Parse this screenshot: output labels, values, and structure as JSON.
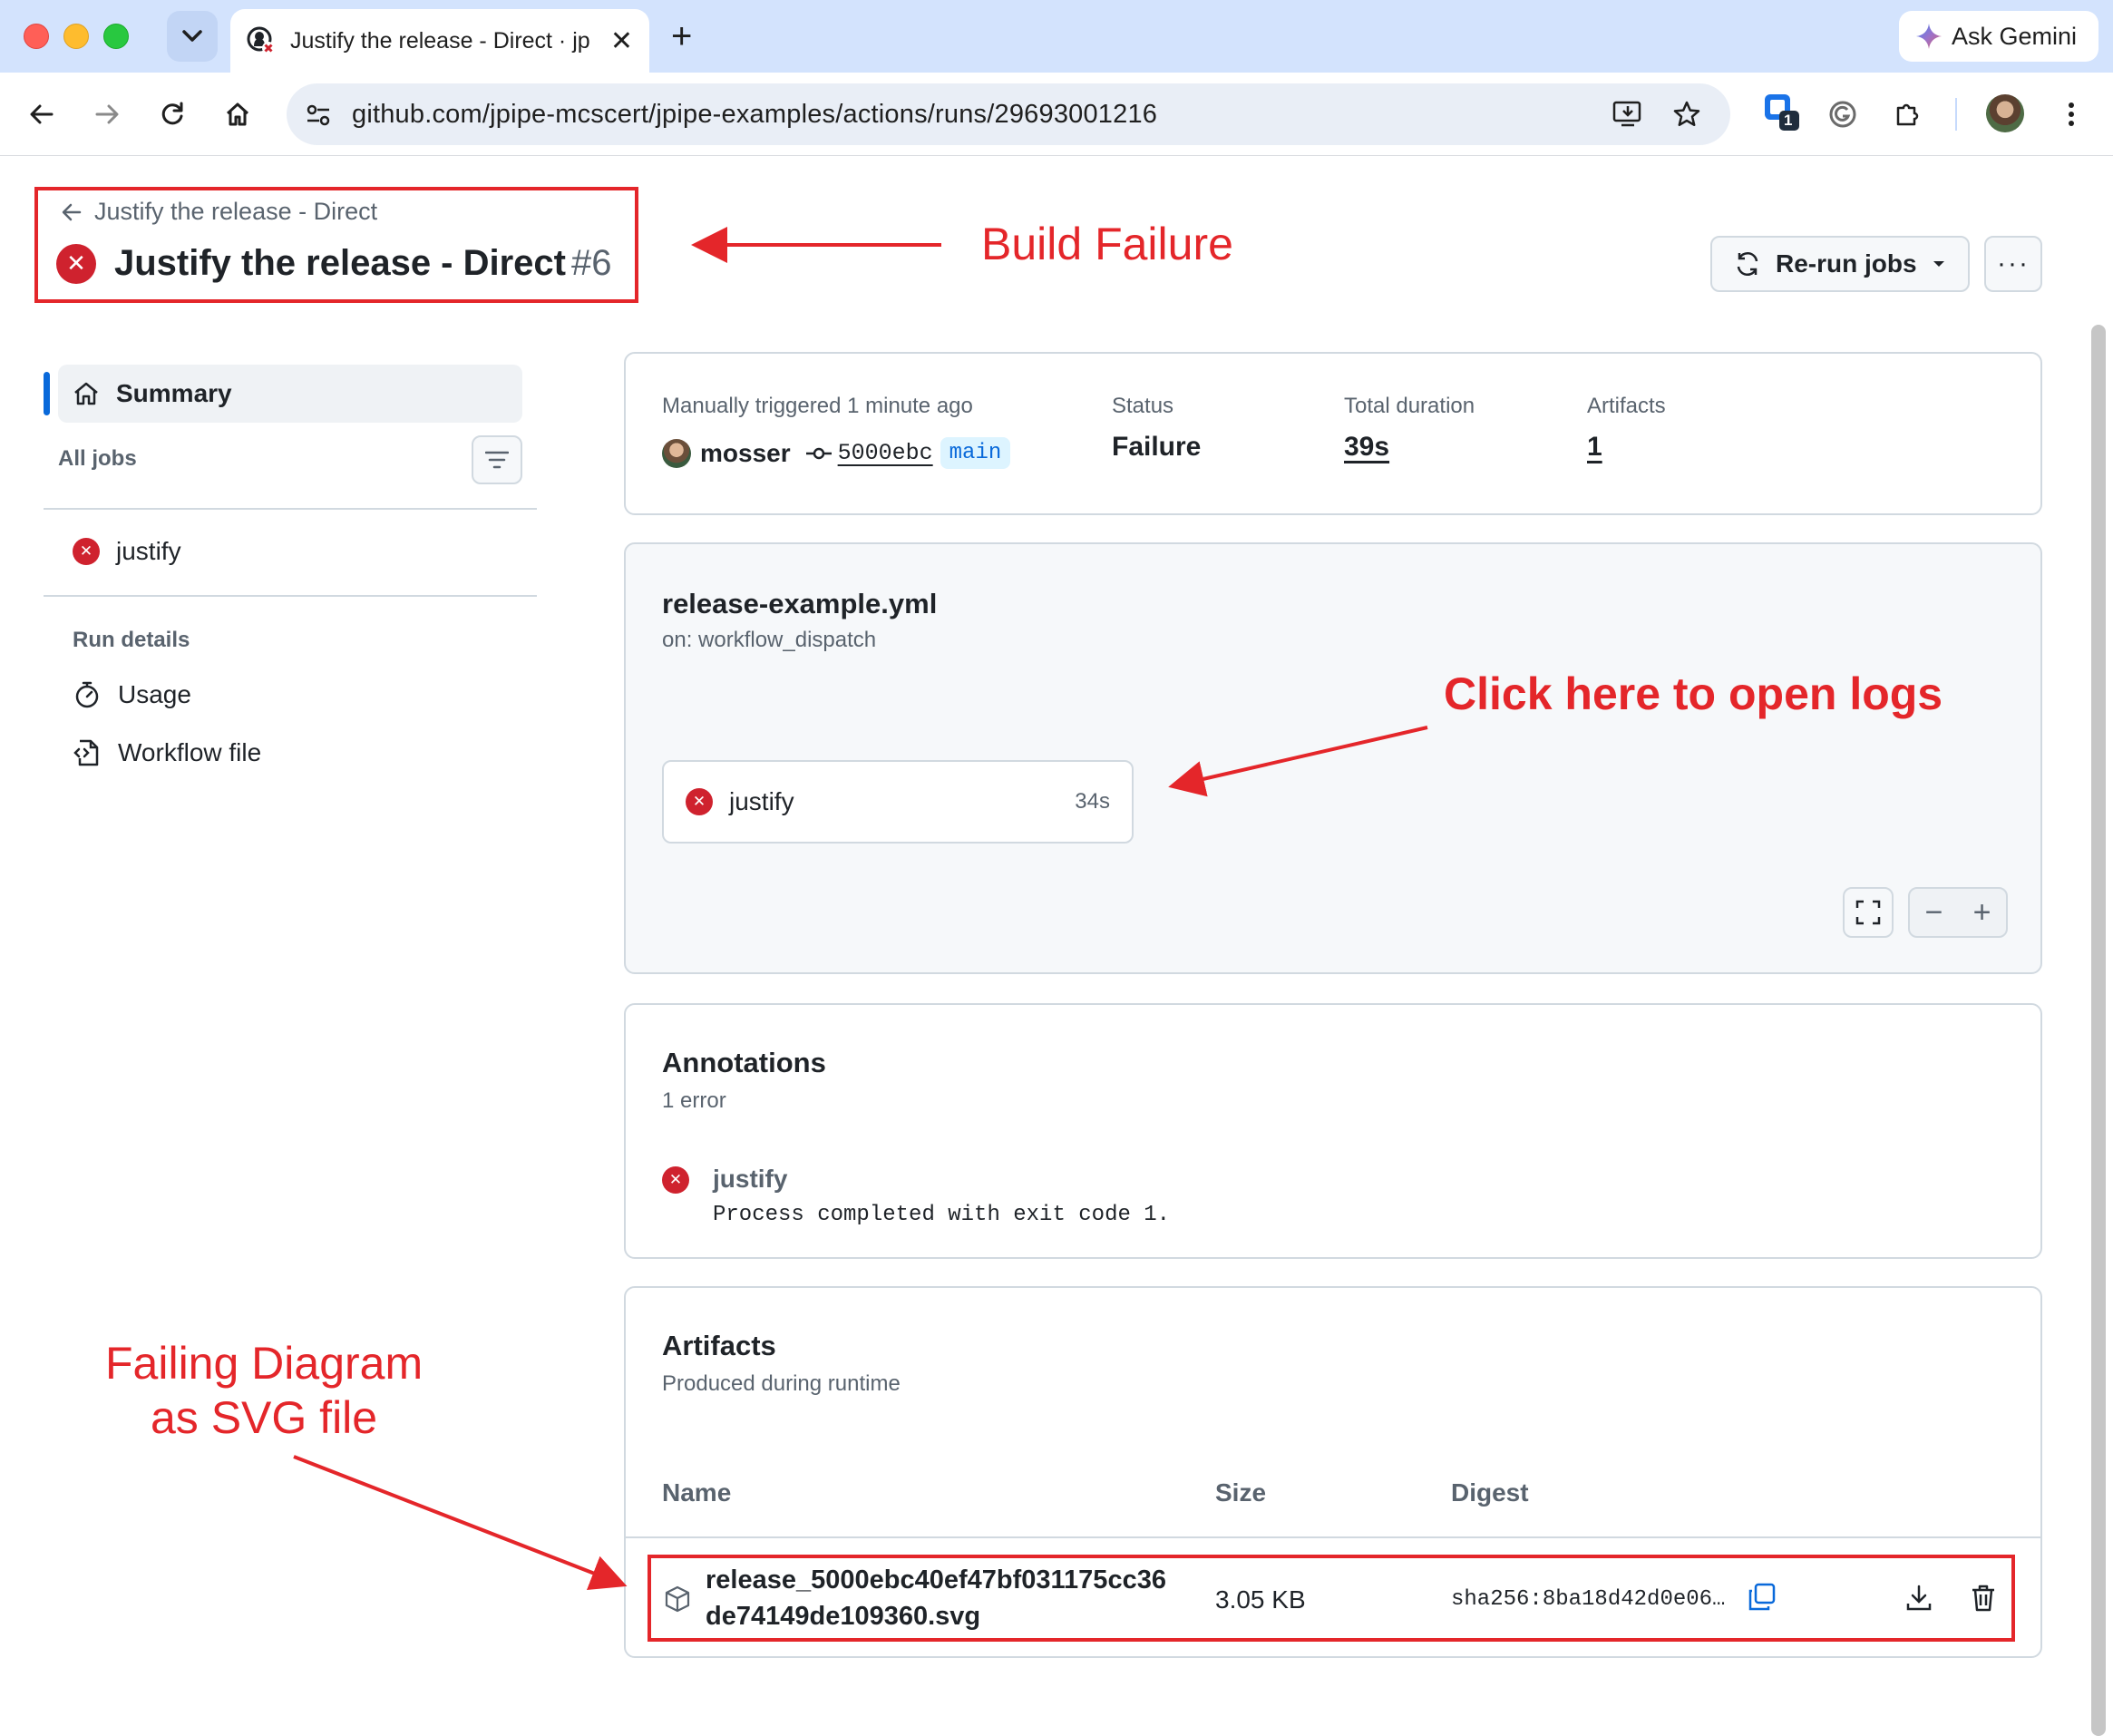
{
  "browser": {
    "tab_title": "Justify the release - Direct · jp",
    "url": "github.com/jpipe-mcscert/jpipe-examples/actions/runs/29693001216",
    "gemini_label": "Ask Gemini",
    "extension_badge": "1",
    "new_tab_symbol": "+",
    "tab_close_symbol": "✕"
  },
  "header": {
    "back_label": "Justify the release - Direct",
    "title": "Justify the release - Direct",
    "run_number": "#6",
    "rerun_label": "Re-run jobs",
    "more_label": "···"
  },
  "sidebar": {
    "summary_label": "Summary",
    "all_jobs_label": "All jobs",
    "jobs": [
      {
        "name": "justify"
      }
    ],
    "run_details_label": "Run details",
    "links": [
      {
        "label": "Usage",
        "icon": "stopwatch-icon"
      },
      {
        "label": "Workflow file",
        "icon": "file-code-icon"
      }
    ]
  },
  "run_meta": {
    "trigger_label": "Manually triggered 1 minute ago",
    "actor": "mosser",
    "commit": "5000ebc",
    "branch": "main",
    "status_label": "Status",
    "status_value": "Failure",
    "duration_label": "Total duration",
    "duration_value": "39s",
    "artifacts_label": "Artifacts",
    "artifacts_value": "1"
  },
  "workflow_graph": {
    "file": "release-example.yml",
    "trigger": "on: workflow_dispatch",
    "job": {
      "name": "justify",
      "duration": "34s"
    },
    "zoom_out": "−",
    "zoom_in": "+"
  },
  "annotations": {
    "title": "Annotations",
    "subtitle": "1 error",
    "items": [
      {
        "job": "justify",
        "message": "Process completed with exit code 1."
      }
    ]
  },
  "artifacts": {
    "title": "Artifacts",
    "subtitle": "Produced during runtime",
    "columns": {
      "name": "Name",
      "size": "Size",
      "digest": "Digest"
    },
    "rows": [
      {
        "name_line1": "release_5000ebc40ef47bf031175cc36",
        "name_line2": "de74149de109360.svg",
        "size": "3.05 KB",
        "digest": "sha256:8ba18d42d0e06…"
      }
    ]
  },
  "callouts": {
    "build_failure": "Build Failure",
    "open_logs": "Click here to open logs",
    "failing_diagram_line1": "Failing Diagram",
    "failing_diagram_line2": "as SVG file"
  },
  "colors": {
    "failure_red": "#cf222e",
    "callout_red": "#e4262a",
    "accent_blue": "#0969da"
  }
}
